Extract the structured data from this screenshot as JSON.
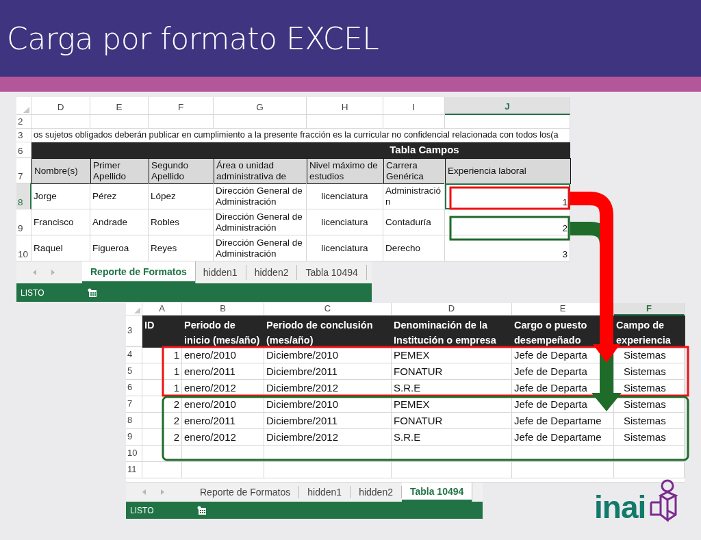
{
  "title": "Carga por formato EXCEL",
  "sheets": [
    {
      "columns": [
        {
          "label": "D",
          "kind": "text",
          "selected": false
        },
        {
          "label": "E",
          "kind": "text",
          "selected": false
        },
        {
          "label": "F",
          "kind": "text",
          "selected": false
        },
        {
          "label": "G",
          "kind": "text",
          "selected": false
        },
        {
          "label": "H",
          "kind": "centered",
          "selected": false
        },
        {
          "label": "I",
          "kind": "text",
          "selected": false
        },
        {
          "label": "J",
          "kind": "number",
          "selected": true
        }
      ],
      "rows": [
        {
          "number": "2",
          "kind": "blank",
          "selected": false
        },
        {
          "number": "3",
          "kind": "note",
          "selected": false,
          "text": "os sujetos obligados deberán publicar en cumplimiento a la presente fracción es la curricular no confidencial relacionada con todos los(a"
        },
        {
          "number": "6",
          "kind": "banner",
          "selected": false,
          "text": "Tabla Campos"
        },
        {
          "number": "7",
          "kind": "header",
          "selected": false,
          "cells": [
            "Nombre(s)",
            "Primer Apellido",
            "Segundo Apellido",
            "Área o unidad administrativa de",
            "Nivel máximo de estudios",
            "Carrera Genérica",
            "Experiencia laboral"
          ]
        },
        {
          "number": "8",
          "kind": "data",
          "selected": true,
          "cells": [
            "Jorge",
            "Pérez",
            "López",
            "Dirección General de Administración",
            "licenciatura",
            "Administración",
            "1"
          ]
        },
        {
          "number": "9",
          "kind": "data",
          "selected": false,
          "cells": [
            "Francisco",
            "Andrade",
            "Robles",
            "Dirección General de Administración",
            "licenciatura",
            "Contaduría",
            "2"
          ]
        },
        {
          "number": "10",
          "kind": "data",
          "selected": false,
          "cells": [
            "Raquel",
            "Figueroa",
            "Reyes",
            "Dirección General de Administración",
            "licenciatura",
            "Derecho",
            "3"
          ]
        }
      ],
      "tabs": [
        {
          "label": "Reporte de Formatos",
          "selected": true
        },
        {
          "label": "hidden1",
          "selected": false
        },
        {
          "label": "hidden2",
          "selected": false
        },
        {
          "label": "Tabla 10494",
          "selected": false
        }
      ],
      "status": "LISTO"
    },
    {
      "columns": [
        {
          "label": "A",
          "kind": "number",
          "selected": false
        },
        {
          "label": "B",
          "kind": "text",
          "selected": false
        },
        {
          "label": "C",
          "kind": "text",
          "selected": false
        },
        {
          "label": "D",
          "kind": "text",
          "selected": false
        },
        {
          "label": "E",
          "kind": "text",
          "selected": false
        },
        {
          "label": "F",
          "kind": "wide",
          "selected": true
        }
      ],
      "rows": [
        {
          "number": "3",
          "kind": "header",
          "selected": false,
          "cells": [
            "ID",
            "Periodo de inicio (mes/año)",
            "Periodo de conclusión (mes/año)",
            "Denominación de la Institución o empresa",
            "Cargo o puesto desempeñado",
            "Campo de experiencia"
          ]
        },
        {
          "number": "4",
          "kind": "data",
          "selected": false,
          "cells": [
            "1",
            "enero/2010",
            "Diciembre/2010",
            "PEMEX",
            "Jefe de Departa",
            "Sistemas"
          ]
        },
        {
          "number": "5",
          "kind": "data",
          "selected": false,
          "cells": [
            "1",
            "enero/2011",
            "Diciembre/2011",
            "FONATUR",
            "Jefe de Departa",
            "Sistemas"
          ]
        },
        {
          "number": "6",
          "kind": "data",
          "selected": false,
          "cells": [
            "1",
            "enero/2012",
            "Diciembre/2012",
            "S.R.E",
            "Jefe de Departa",
            "Sistemas"
          ]
        },
        {
          "number": "7",
          "kind": "data",
          "selected": false,
          "cells": [
            "2",
            "enero/2010",
            "Diciembre/2010",
            "PEMEX",
            "Jefe de Departa",
            "Sistemas"
          ]
        },
        {
          "number": "8",
          "kind": "data",
          "selected": false,
          "cells": [
            "2",
            "enero/2011",
            "Diciembre/2011",
            "FONATUR",
            "Jefe de Departame",
            "Sistemas"
          ]
        },
        {
          "number": "9",
          "kind": "data",
          "selected": false,
          "cells": [
            "2",
            "enero/2012",
            "Diciembre/2012",
            "S.R.E",
            "Jefe de Departame",
            "Sistemas"
          ]
        },
        {
          "number": "10",
          "kind": "blank",
          "selected": false
        },
        {
          "number": "11",
          "kind": "blank",
          "selected": false
        }
      ],
      "tabs": [
        {
          "label": "Reporte de Formatos",
          "selected": false
        },
        {
          "label": "hidden1",
          "selected": false
        },
        {
          "label": "hidden2",
          "selected": false
        },
        {
          "label": "Tabla 10494",
          "selected": true
        }
      ],
      "status": "LISTO"
    }
  ],
  "logo": "inai"
}
